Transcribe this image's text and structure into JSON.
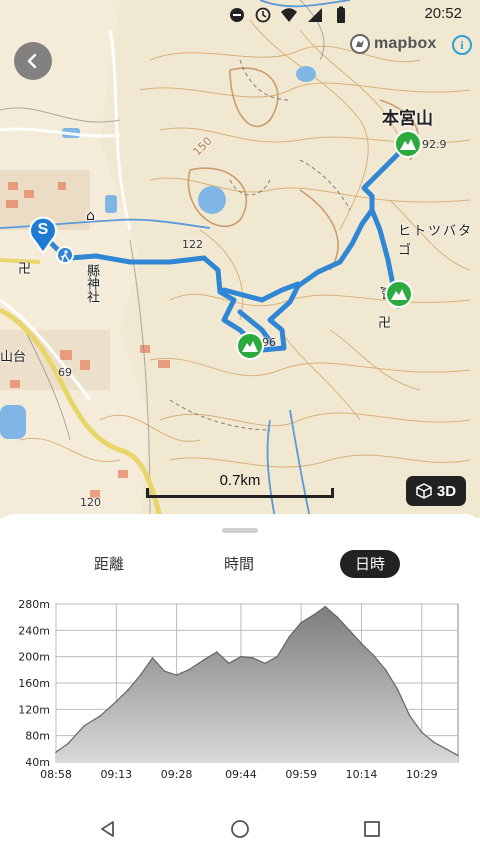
{
  "status_bar": {
    "time": "20:52",
    "icons": [
      "minus-circle-icon",
      "clock-icon",
      "wifi-icon",
      "signal-icon",
      "battery-icon"
    ]
  },
  "map": {
    "logo_text": "mapbox",
    "info_symbol": "i",
    "labels": {
      "mountain": "本宮山",
      "shrine": "縣神社",
      "hitotsubata": "ヒトツバタゴ",
      "area": "山台",
      "elev_122": "122",
      "elev_69": "69",
      "elev_120": "120",
      "elev_150": "150",
      "elev_92": "92.9",
      "elev_96": "96"
    },
    "scale_text": "0.7km",
    "btn_3d_label": "3D",
    "start_marker": "S",
    "colors": {
      "route": "#2f86d4",
      "peak_marker": "#2daa3e",
      "start_marker": "#1f7ad4"
    }
  },
  "sheet": {
    "tabs": [
      {
        "label": "距離",
        "active": false
      },
      {
        "label": "時間",
        "active": false
      },
      {
        "label": "日時",
        "active": true
      }
    ]
  },
  "chart_data": {
    "type": "area",
    "title": "",
    "xlabel": "",
    "ylabel": "",
    "x_ticks": [
      "08:58",
      "09:13",
      "09:28",
      "09:44",
      "09:59",
      "10:14",
      "10:29"
    ],
    "y_ticks": [
      "40m",
      "80m",
      "120m",
      "160m",
      "200m",
      "240m",
      "280m"
    ],
    "ylim": [
      40,
      280
    ],
    "grid": true,
    "x": [
      "08:58",
      "09:01",
      "09:05",
      "09:09",
      "09:13",
      "09:16",
      "09:19",
      "09:22",
      "09:25",
      "09:28",
      "09:31",
      "09:35",
      "09:38",
      "09:41",
      "09:44",
      "09:47",
      "09:50",
      "09:53",
      "09:56",
      "09:59",
      "10:02",
      "10:05",
      "10:08",
      "10:11",
      "10:14",
      "10:17",
      "10:20",
      "10:23",
      "10:26",
      "10:29",
      "10:32",
      "10:35",
      "10:38"
    ],
    "values": [
      55,
      68,
      95,
      110,
      132,
      150,
      172,
      198,
      178,
      172,
      180,
      196,
      207,
      190,
      200,
      198,
      190,
      200,
      230,
      252,
      263,
      276,
      260,
      240,
      220,
      202,
      180,
      150,
      110,
      85,
      70,
      60,
      50
    ]
  },
  "nav": {
    "icons": [
      "back-triangle-icon",
      "home-circle-icon",
      "recents-square-icon"
    ]
  }
}
